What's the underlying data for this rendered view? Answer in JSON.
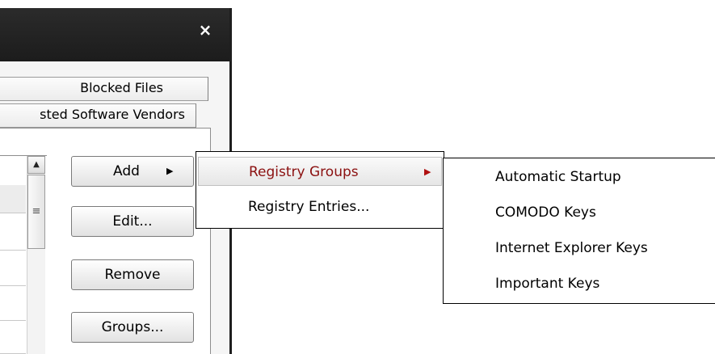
{
  "dialog": {
    "close_glyph": "×"
  },
  "tabs": {
    "blocked_files": "Blocked Files",
    "trusted_vendors": "sted Software Vendors"
  },
  "list": {
    "scroll_up_glyph": "▲",
    "thumb_grip_glyph": "≡"
  },
  "buttons": {
    "add_label": "Add",
    "add_arrow": "▶",
    "edit_label": "Edit...",
    "remove_label": "Remove",
    "groups_label": "Groups..."
  },
  "add_menu": {
    "items": [
      {
        "label": "Registry Groups",
        "arrow": "▶",
        "highlighted": true
      },
      {
        "label": "Registry Entries...",
        "highlighted": false
      }
    ]
  },
  "registry_groups_menu": {
    "items": [
      {
        "label": "Automatic Startup"
      },
      {
        "label": "COMODO Keys"
      },
      {
        "label": "Internet Explorer Keys"
      },
      {
        "label": "Important Keys"
      }
    ]
  },
  "colors": {
    "titlebar": "#222222",
    "highlight_text": "#8b1010",
    "submenu_arrow": "#b01010"
  }
}
